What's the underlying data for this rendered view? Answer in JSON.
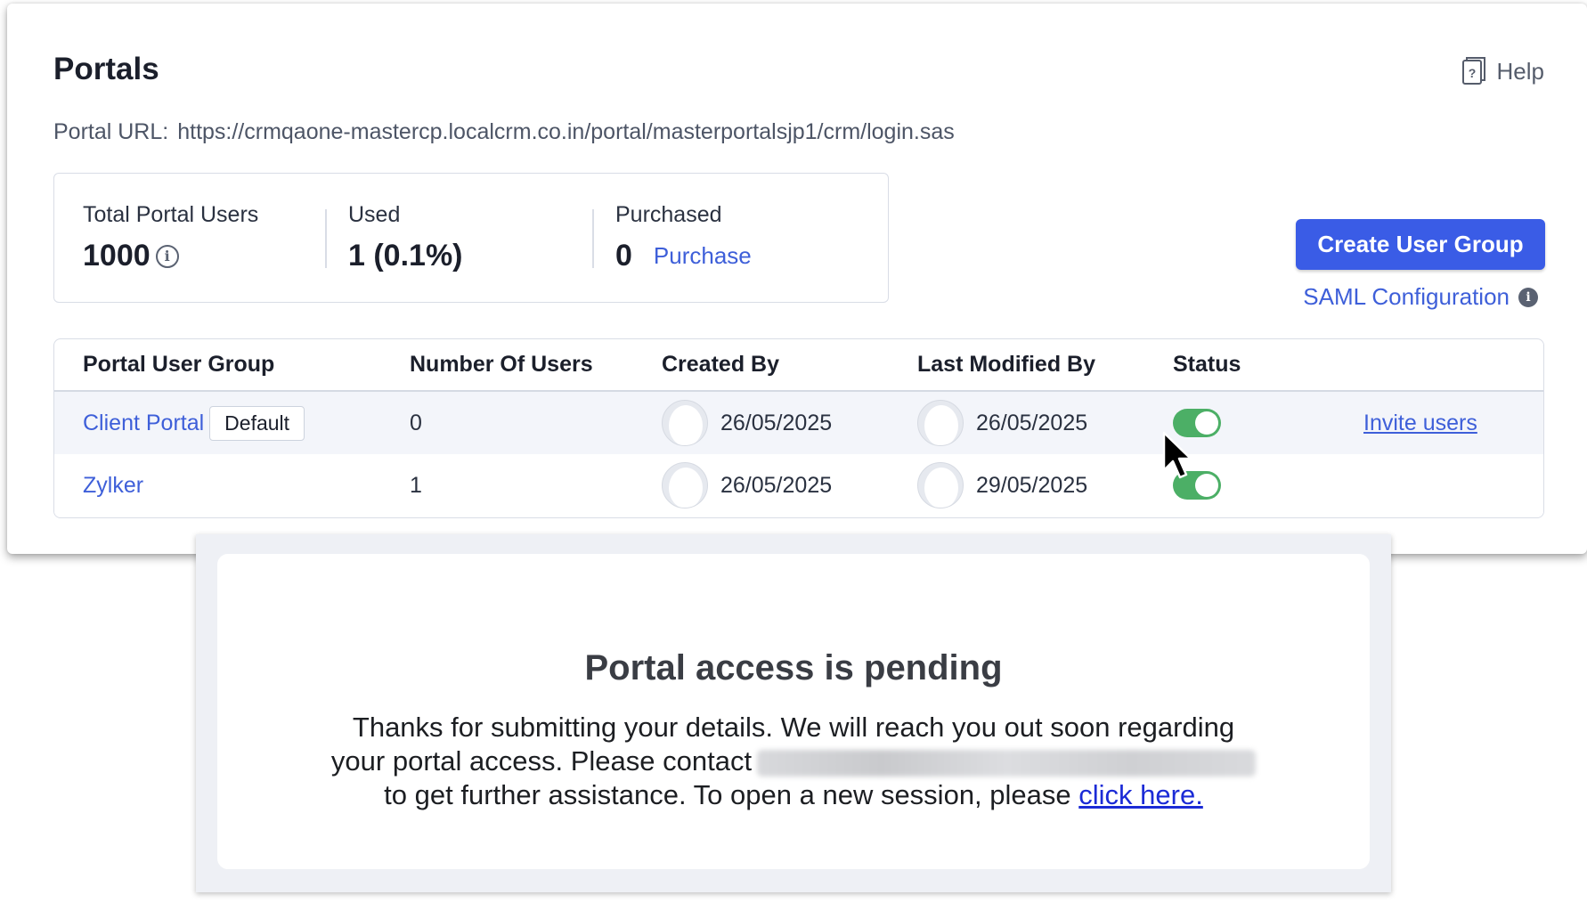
{
  "header": {
    "title": "Portals",
    "help_label": "Help",
    "portal_url_label": "Portal URL:",
    "portal_url": "https://crmqaone-mastercp.localcrm.co.in/portal/masterportalsjp1/crm/login.sas"
  },
  "stats": {
    "total_label": "Total Portal Users",
    "total_value": "1000",
    "used_label": "Used",
    "used_value": "1 (0.1%)",
    "purchased_label": "Purchased",
    "purchased_value": "0",
    "purchase_link": "Purchase"
  },
  "actions": {
    "create_user_group": "Create User Group",
    "saml_configuration": "SAML Configuration"
  },
  "table": {
    "columns": [
      "Portal User Group",
      "Number Of Users",
      "Created By",
      "Last Modified By",
      "Status"
    ],
    "rows": [
      {
        "group": "Client Portal",
        "badge": "Default",
        "users": "0",
        "created": "26/05/2025",
        "modified": "26/05/2025",
        "status": "on",
        "action": "Invite users"
      },
      {
        "group": "Zylker",
        "users": "1",
        "created": "26/05/2025",
        "modified": "29/05/2025",
        "status": "on"
      }
    ]
  },
  "pending": {
    "title": "Portal access is pending",
    "line1": "Thanks for submitting your details. We will reach you out soon regarding",
    "line2": "your portal access. Please contact",
    "line3": "to get further assistance. To open a new session, please",
    "link": "click here."
  },
  "colors": {
    "accent": "#3a5ce6",
    "link": "#3e5fd9",
    "toggle_on": "#4caf66"
  },
  "icons": [
    "help-book-icon",
    "info-icon",
    "avatar-icon",
    "toggle-icon",
    "mouse-cursor-icon"
  ]
}
